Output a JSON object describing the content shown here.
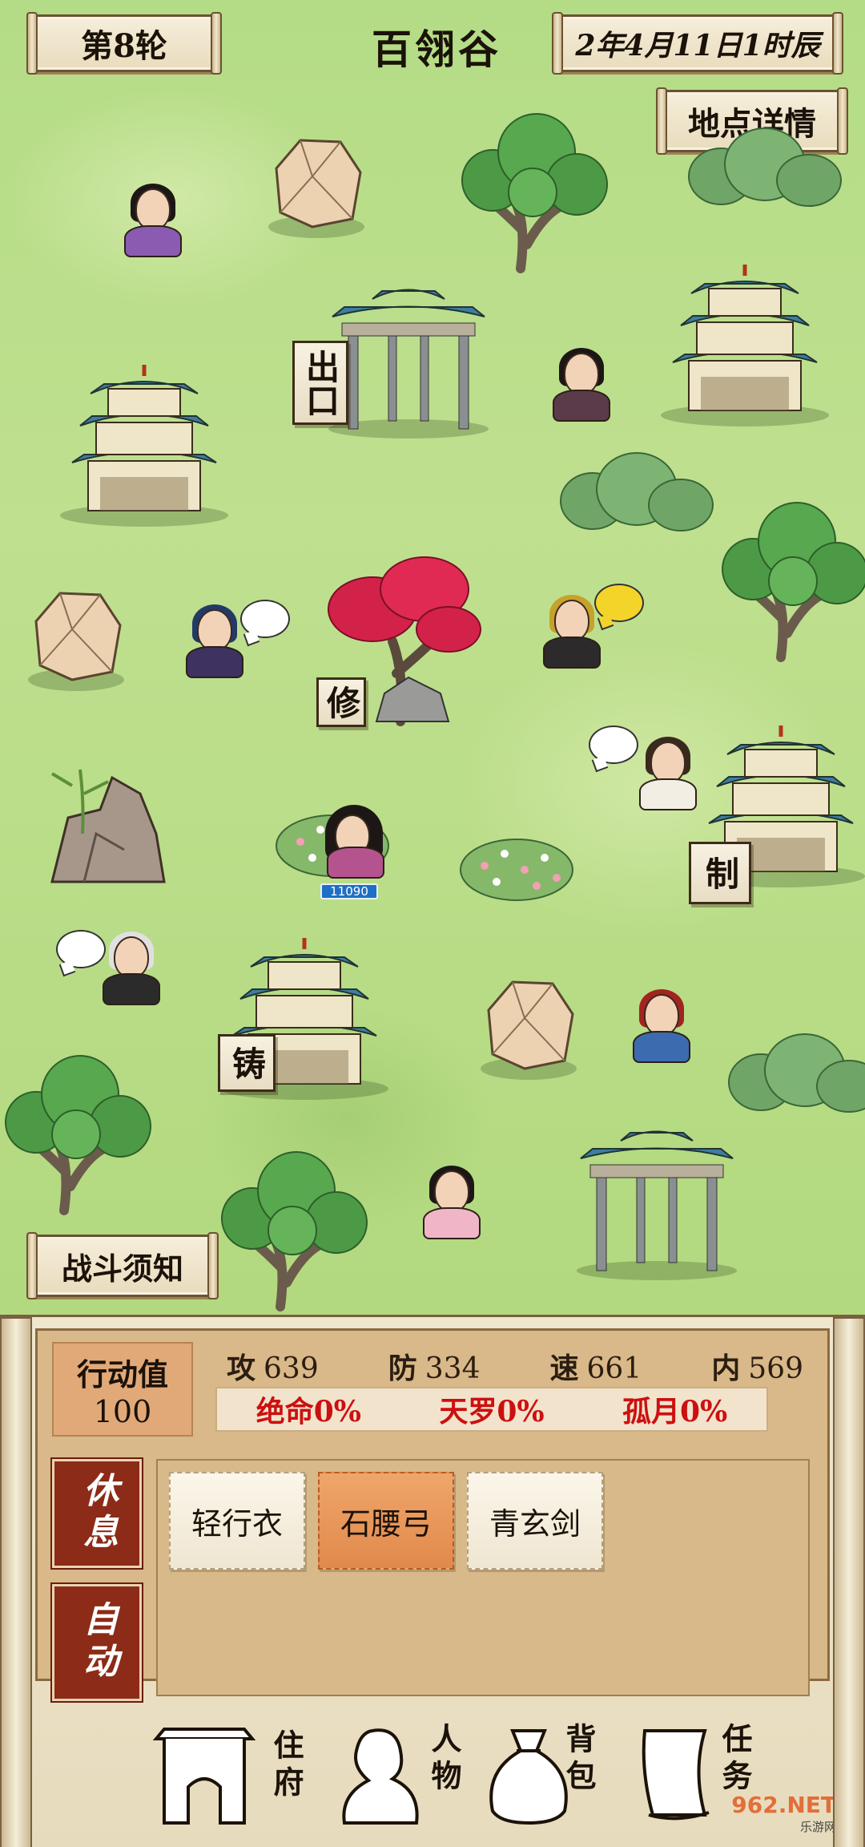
{
  "header": {
    "round": "第8轮",
    "title": "百翎谷",
    "date": "2年4月11日1时辰",
    "detail_button": "地点详情"
  },
  "map": {
    "place_tags": {
      "exit": "出口",
      "repair": "修",
      "craft": "制",
      "forge": "铸"
    },
    "player_level": "11090",
    "battle_tips_button": "战斗须知"
  },
  "stats": {
    "action_label": "行动值",
    "action_value": "100",
    "attributes": [
      {
        "name": "攻",
        "value": "639"
      },
      {
        "name": "防",
        "value": "334"
      },
      {
        "name": "速",
        "value": "661"
      },
      {
        "name": "内",
        "value": "569"
      }
    ],
    "crits": [
      "绝命0%",
      "天罗0%",
      "孤月0%"
    ]
  },
  "actions": {
    "rest": "休息",
    "auto": "自动"
  },
  "equipment": [
    {
      "name": "轻行衣",
      "selected": false
    },
    {
      "name": "石腰弓",
      "selected": true
    },
    {
      "name": "青玄剑",
      "selected": false
    }
  ],
  "nav": [
    {
      "label": "住府",
      "icon": "gate-icon"
    },
    {
      "label": "人物",
      "icon": "person-icon"
    },
    {
      "label": "背包",
      "icon": "bag-icon"
    },
    {
      "label": "任务",
      "icon": "scroll-icon"
    }
  ],
  "watermark": {
    "text": "962.NET",
    "sub": "乐游网"
  },
  "colors": {
    "grass": "#b9d98a",
    "panel": "#efe6ce",
    "side_button": "#8c2b17",
    "selected_card": "#e2894c",
    "crit_text": "#cc1010",
    "level_badge": "#1f6fc5"
  }
}
